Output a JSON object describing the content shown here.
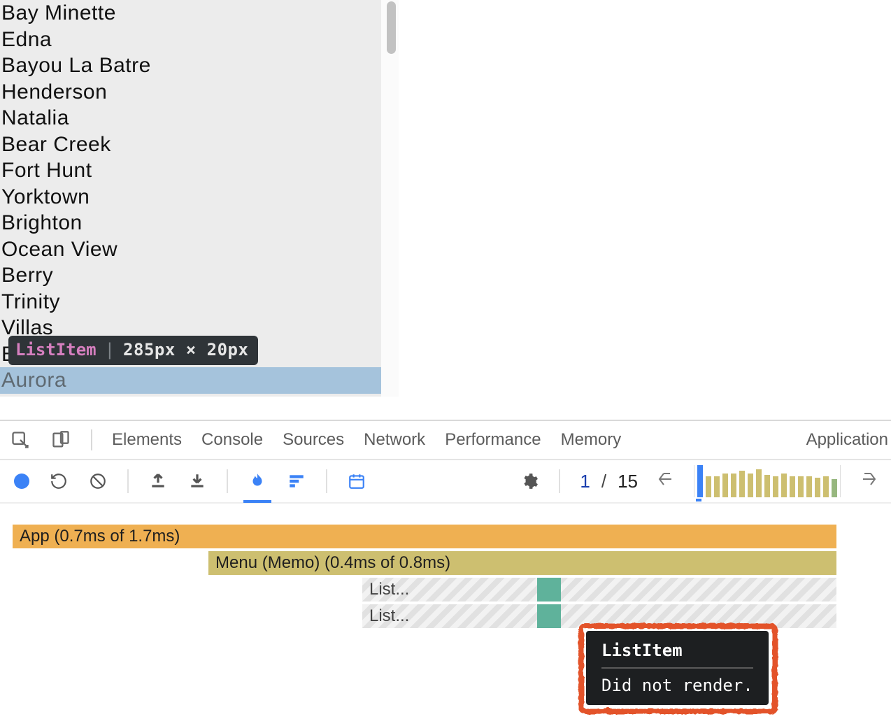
{
  "app_list": {
    "items": [
      "Bay Minette",
      "Edna",
      "Bayou La Batre",
      "Henderson",
      "Natalia",
      "Bear Creek",
      "Fort Hunt",
      "Yorktown",
      "Brighton",
      "Ocean View",
      "Berry",
      "Trinity",
      "Villas",
      "E",
      "Aurora"
    ],
    "highlighted_index": 14
  },
  "inspect_tooltip": {
    "element": "ListItem",
    "dims": "285px × 20px"
  },
  "devtools_tabs": {
    "items": [
      "Elements",
      "Console",
      "Sources",
      "Network",
      "Performance",
      "Memory",
      "Application"
    ]
  },
  "profiler": {
    "page_current": "1",
    "page_sep": "/",
    "page_total": "15",
    "minibar_heights": [
      46,
      30,
      30,
      34,
      34,
      38,
      34,
      40,
      32,
      30,
      34,
      30,
      30,
      30,
      28,
      30,
      26
    ],
    "minibar_selected_index": 0,
    "minibar_green_index": 16
  },
  "flame": {
    "row_app": "App (0.7ms of 1.7ms)",
    "row_menu": "Menu (Memo) (0.4ms of 0.8ms)",
    "row_li": "List..."
  },
  "dnr_tooltip": {
    "title": "ListItem",
    "body": "Did not render."
  }
}
